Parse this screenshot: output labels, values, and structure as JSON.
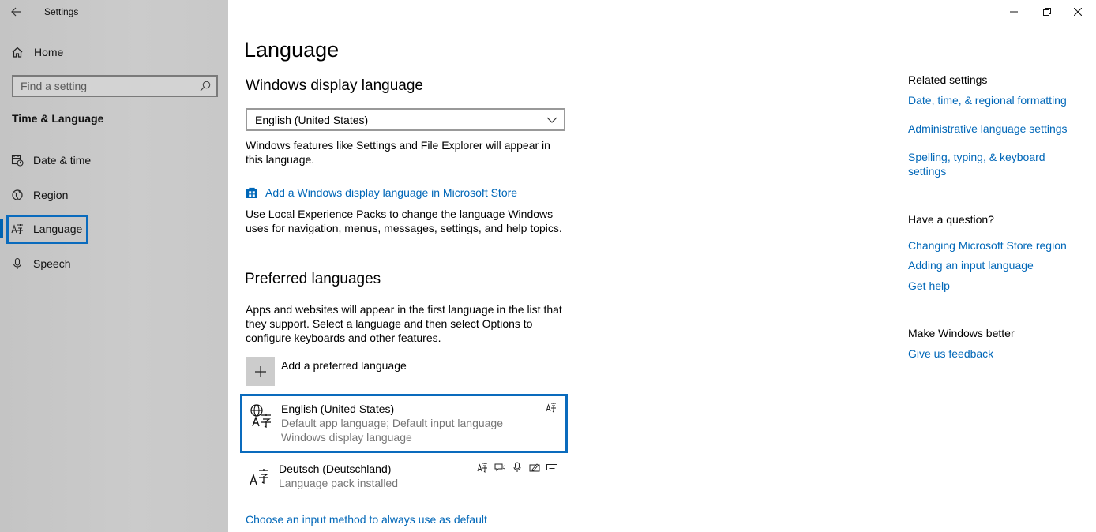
{
  "window": {
    "title": "Settings",
    "controls": [
      "minimize",
      "restore",
      "close"
    ]
  },
  "sidebar": {
    "home_label": "Home",
    "search_placeholder": "Find a setting",
    "section_title": "Time & Language",
    "items": [
      {
        "label": "Date & time",
        "icon": "calendar-clock-icon"
      },
      {
        "label": "Region",
        "icon": "globe-icon"
      },
      {
        "label": "Language",
        "icon": "language-icon",
        "selected": true
      },
      {
        "label": "Speech",
        "icon": "microphone-icon"
      }
    ]
  },
  "main": {
    "title": "Language",
    "display_language": {
      "heading": "Windows display language",
      "selected": "English (United States)",
      "description": "Windows features like Settings and File Explorer will appear in this language.",
      "store_link": "Add a Windows display language in Microsoft Store",
      "lxp_description": "Use Local Experience Packs to change the language Windows uses for navigation, menus, messages, settings, and help topics."
    },
    "preferred": {
      "heading": "Preferred languages",
      "description": "Apps and websites will appear in the first language in the list that they support. Select a language and then select Options to configure keyboards and other features.",
      "add_label": "Add a preferred language",
      "languages": [
        {
          "name": "English (United States)",
          "line1": "Default app language; Default input language",
          "line2": "Windows display language",
          "selected": true
        },
        {
          "name": "Deutsch (Deutschland)",
          "line1": "Language pack installed"
        }
      ],
      "input_method_link": "Choose an input method to always use as default"
    }
  },
  "related": {
    "heading": "Related settings",
    "links": [
      "Date, time, & regional formatting",
      "Administrative language settings",
      "Spelling, typing, & keyboard settings"
    ],
    "question_heading": "Have a question?",
    "question_links": [
      "Changing Microsoft Store region",
      "Adding an input language",
      "Get help"
    ],
    "better_heading": "Make Windows better",
    "better_link": "Give us feedback"
  },
  "colors": {
    "accent": "#0067b8",
    "selection_border": "#0a6bbd",
    "sidebar_bg": "#c8c8c8",
    "muted_text": "#767676"
  }
}
